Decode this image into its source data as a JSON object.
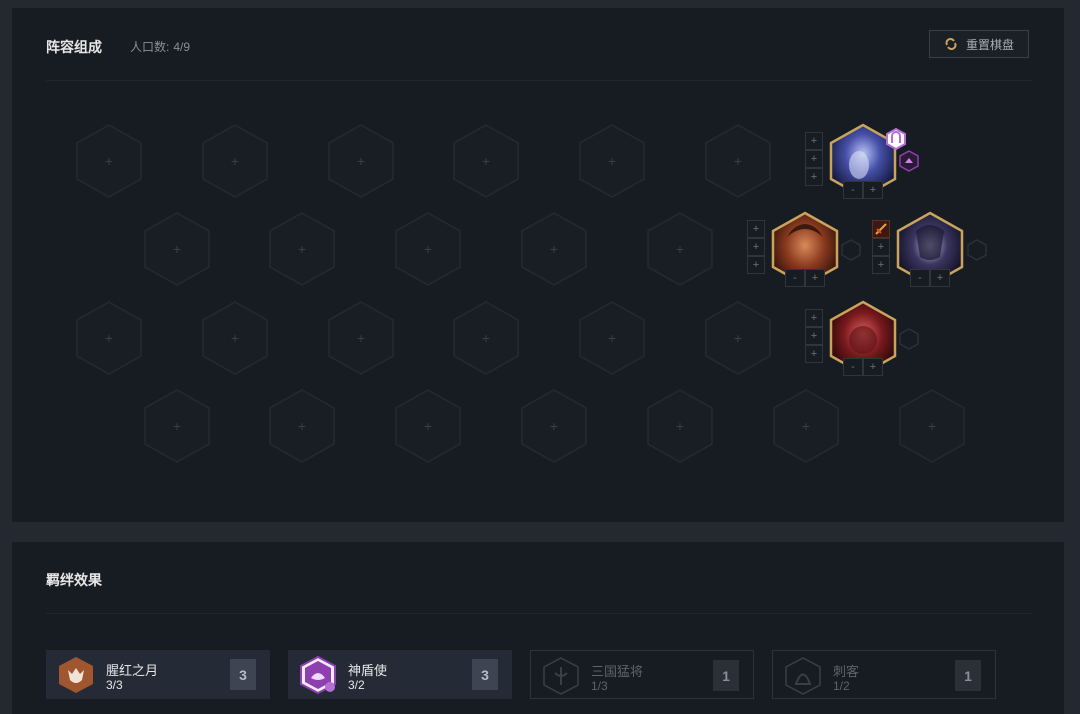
{
  "board": {
    "title": "阵容组成",
    "population_label": "人口数:",
    "population_value": "4/9",
    "reset_label": "重置棋盘",
    "slot_plus": "+"
  },
  "champions": [
    {
      "name": "champion-top",
      "stars": "-  +",
      "trait_badge": "ward-icon"
    },
    {
      "name": "champion-mid-left",
      "stars": "-  +"
    },
    {
      "name": "champion-mid-right",
      "stars": "-  +",
      "item": "sword-item-icon"
    },
    {
      "name": "champion-bottom",
      "stars": "-  +"
    }
  ],
  "traits": {
    "title": "羁绊效果",
    "items": [
      {
        "name": "腥红之月",
        "count": "3/3",
        "level": "3",
        "icon": "crimson-moon-icon",
        "active": true,
        "color": "#a0572f"
      },
      {
        "name": "神盾使",
        "count": "3/2",
        "level": "3",
        "icon": "aegis-icon",
        "active": true,
        "color": "#8e3fb0"
      },
      {
        "name": "三国猛将",
        "count": "1/3",
        "level": "1",
        "icon": "warlord-icon",
        "active": false
      },
      {
        "name": "刺客",
        "count": "1/2",
        "level": "1",
        "icon": "assassin-icon",
        "active": false
      }
    ]
  },
  "colors": {
    "gold_border": "#c9a45c",
    "purple_badge": "#b36fd6",
    "panel_bg": "#171b22",
    "page_bg": "#232831"
  }
}
